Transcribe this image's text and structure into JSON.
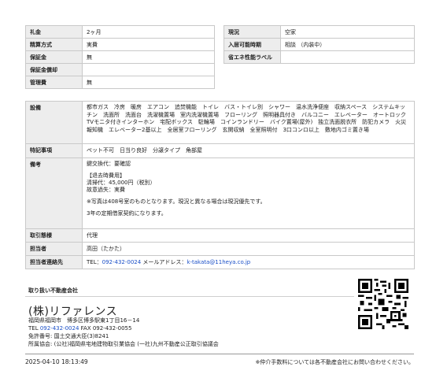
{
  "top_left": [
    {
      "label": "礼金",
      "value": "2ヶ月"
    },
    {
      "label": "精算方式",
      "value": "実費"
    },
    {
      "label": "保証金",
      "value": "無"
    },
    {
      "label": "保証金償却",
      "value": ""
    },
    {
      "label": "管理費",
      "value": "無"
    }
  ],
  "top_right": [
    {
      "label": "現況",
      "value": "空家"
    },
    {
      "label": "入居可能時期",
      "value": "相談 （内装中）"
    },
    {
      "label": "省エネ性能ラベル",
      "value": ""
    }
  ],
  "facilities": {
    "label": "設備",
    "value": "都市ガス　冷房　暖房　エアコン　追焚機能　トイレ　バス・トイレ別　シャワー　温水洗浄便座　収納スペース　システムキッチン　洗面所　洗面台　洗濯機置場　室内洗濯機置場　フローリング　照明器具付き　バルコニー　エレベーター　オートロック　TVモニタ付きインターホン　宅配ボックス　駐輪場　コインランドリー　バイク置場(屋外)　独立洗面脱衣所　防犯カメラ　火災報知機　エレベーター2基以上　全居室フローリング　玄関収納　全室照明付　3口コンロ以上　敷地内ゴミ置き場"
  },
  "features": {
    "label": "特記事項",
    "value": "ペット不可　日当り良好　分譲タイプ　角部屋"
  },
  "remarks": {
    "label": "備考",
    "lines": [
      "鍵交換代：要確認",
      "",
      "【退去時費用】",
      "清掃代：45,000円（税別）",
      "故意過失：実費",
      "",
      "※写真は408号室のものとなります。現況と異なる場合は現況優先です。",
      "",
      "3年の定期借家契約になります。"
    ]
  },
  "transaction": {
    "label": "取引態様",
    "value": "代理"
  },
  "person": {
    "label": "担当者",
    "value": "高田（たかた）"
  },
  "contact": {
    "label": "担当者連絡先",
    "tel_prefix": "TEL：",
    "tel": "092-432-0024",
    "mail_prefix": " メールアドレス：",
    "mail": "k-takata@11heya.co.jp"
  },
  "company": {
    "section_title": "取り扱い不動産会社",
    "name": "(株)リファレンス",
    "address": "福岡県福岡市　博多区博多駅東1丁目16－14",
    "tel_prefix": "TEL ",
    "tel": "092-432-0024",
    "fax": " FAX 092-432-0055",
    "license": "免許番号: 国土交通大臣(3)8241",
    "association": "所属協会: (公社)福岡県宅地建物取引業協会 (一社)九州不動産公正取引協議会"
  },
  "footer": {
    "timestamp": "2025-04-10 18:13:49",
    "note": "※仲介手数料については各不動産会社にお問い合わせください。"
  }
}
